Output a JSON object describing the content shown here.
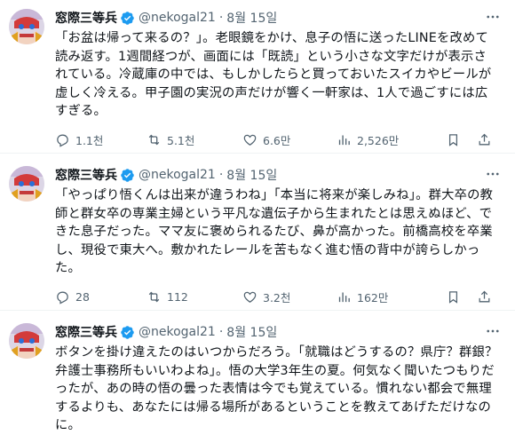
{
  "colors": {
    "text": "#0f1419",
    "muted": "#536471",
    "verified": "#1d9bf0",
    "divider": "#eff3f4"
  },
  "tweets": [
    {
      "name": "窓際三等兵",
      "handle": "@nekogal21",
      "dot": "·",
      "date": "8월 15일",
      "text": "「お盆は帰って来るの？」。老眼鏡をかけ、息子の悟に送ったLINEを改めて読み返す。1週間経つが、画面には「既読」という小さな文字だけが表示されている。冷蔵庫の中では、もしかしたらと買っておいたスイカやビールが虚しく冷える。甲子園の実況の声だけが響く一軒家は、1人で過ごすには広すぎる。",
      "replies": "1.1천",
      "retweets": "5.1천",
      "likes": "6.6만",
      "views": "2,526만"
    },
    {
      "name": "窓際三等兵",
      "handle": "@nekogal21",
      "dot": "·",
      "date": "8월 15일",
      "text": "「やっぱり悟くんは出来が違うわね」「本当に将来が楽しみね」。群大卒の教師と群女卒の専業主婦という平凡な遺伝子から生まれたとは思えぬほど、できた息子だった。ママ友に褒められるたび、鼻が高かった。前橋高校を卒業し、現役で東大へ。敷かれたレールを苦もなく進む悟の背中が誇らしかった。",
      "replies": "28",
      "retweets": "112",
      "likes": "3.2천",
      "views": "162만"
    },
    {
      "name": "窓際三等兵",
      "handle": "@nekogal21",
      "dot": "·",
      "date": "8월 15일",
      "text": "ボタンを掛け違えたのはいつからだろう。「就職はどうするの？県庁？群銀？弁護士事務所もいいわよね」。悟の大学3年生の夏。何気なく聞いたつもりだったが、あの時の悟の曇った表情は今でも覚えている。慣れない都会で無理するよりも、あなたには帰る場所があるということを教えてあげただけなのに。"
    }
  ]
}
